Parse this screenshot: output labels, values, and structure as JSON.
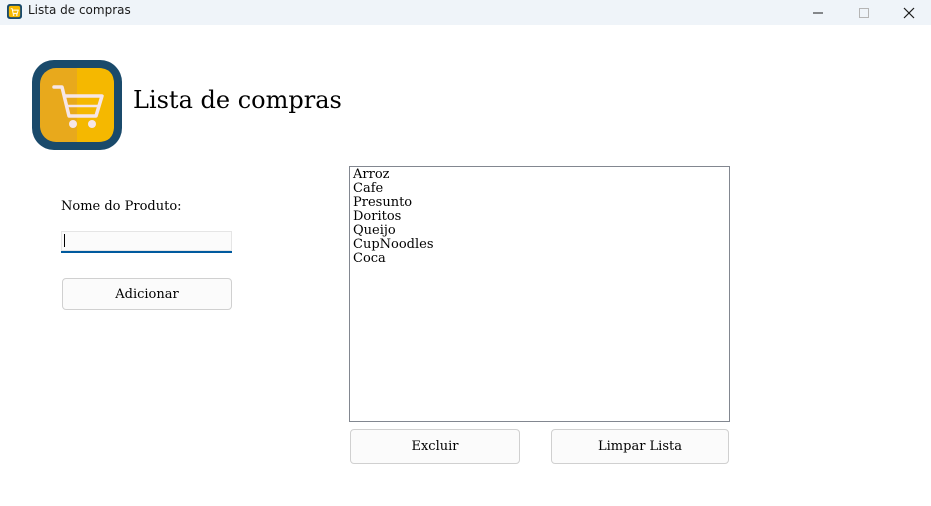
{
  "window": {
    "title": "Lista de compras",
    "controls": {
      "minimize": "minimize-icon",
      "maximize": "maximize-icon",
      "close": "close-icon"
    }
  },
  "header": {
    "logo_icon": "shopping-cart-icon",
    "title": "Lista de compras"
  },
  "form": {
    "product_label": "Nome do Produto:",
    "product_value": "",
    "add_button": "Adicionar"
  },
  "list": {
    "items": [
      "Arroz",
      "Cafe",
      "Presunto",
      "Doritos",
      "Queijo",
      "CupNoodles",
      "Coca"
    ]
  },
  "actions": {
    "delete_button": "Excluir",
    "clear_button": "Limpar Lista"
  },
  "colors": {
    "logo_background": "#1a4a6b",
    "logo_yellow": "#f5b800",
    "input_focus_border": "#005a9e",
    "titlebar_background": "#eff4f9"
  }
}
